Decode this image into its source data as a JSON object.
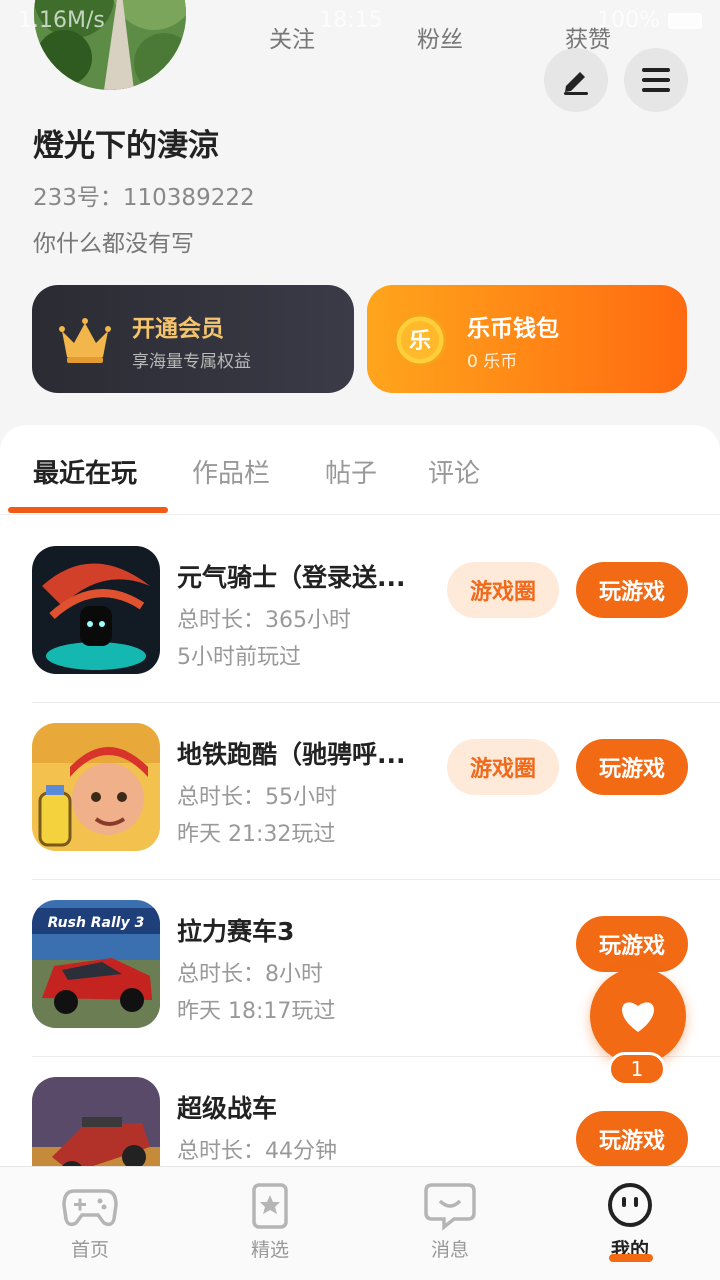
{
  "status_bar": {
    "left_text": "1.16M/s",
    "time": "18:15",
    "battery": "100%"
  },
  "profile": {
    "nickname": "燈光下的淒涼",
    "uid_label": "233号：110389222",
    "bio": "你什么都没有写",
    "stats": [
      {
        "label": "关注"
      },
      {
        "label": "粉丝"
      },
      {
        "label": "获赞"
      }
    ]
  },
  "cards": {
    "vip": {
      "title": "开通会员",
      "subtitle": "享海量专属权益"
    },
    "wallet": {
      "title": "乐币钱包",
      "subtitle": "0 乐币",
      "coin_char": "乐"
    }
  },
  "tabs": [
    "最近在玩",
    "作品栏",
    "帖子",
    "评论"
  ],
  "games": [
    {
      "name": "元气骑士（登录送...",
      "playtime": "总时长：365小时",
      "last_played": "5小时前玩过",
      "circle_label": "游戏圈",
      "play_label": "玩游戏"
    },
    {
      "name": "地铁跑酷（驰骋呼...",
      "playtime": "总时长：55小时",
      "last_played": "昨天 21:32玩过",
      "circle_label": "游戏圈",
      "play_label": "玩游戏"
    },
    {
      "name": "拉力赛车3",
      "playtime": "总时长：8小时",
      "last_played": "昨天 18:17玩过",
      "play_label": "玩游戏",
      "icon_text": "Rush Rally 3"
    },
    {
      "name": "超级战车",
      "playtime": "总时长：44分钟",
      "play_label": "玩游戏"
    }
  ],
  "fab": {
    "badge": "1"
  },
  "bottom_nav": [
    {
      "label": "首页",
      "icon": "gamepad-icon"
    },
    {
      "label": "精选",
      "icon": "star-bookmark-icon"
    },
    {
      "label": "消息",
      "icon": "chat-smile-icon"
    },
    {
      "label": "我的",
      "icon": "face-icon"
    }
  ],
  "colors": {
    "accent": "#f26a14",
    "vip_gold": "#f5c56d"
  }
}
